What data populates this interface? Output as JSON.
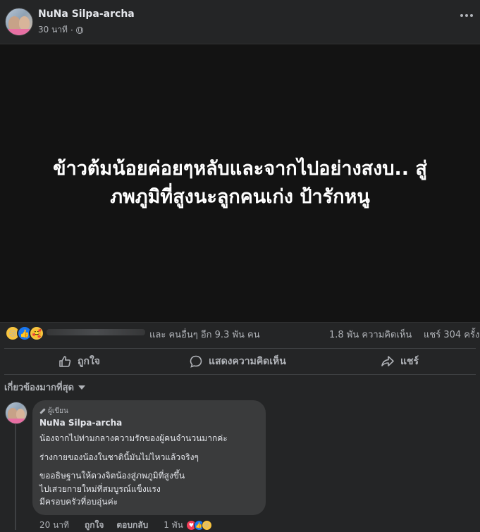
{
  "post": {
    "author": "NuNa Silpa-archa",
    "time": "30 นาที",
    "separator": "·",
    "privacy_icon": "globe-icon",
    "menu_icon": "more-horizontal-icon",
    "image_text_line1": "ข้าวต้มน้อยค่อยๆหลับและจากไปอย่างสงบ.. สู่",
    "image_text_line2": "ภพภูมิที่สูงนะลูกคนเก่ง ป้ารักหนู"
  },
  "stats": {
    "reactions": [
      "sad",
      "like",
      "care"
    ],
    "others": "และ คนอื่นๆ อีก 9.3 พัน คน",
    "comments": "1.8 พัน ความคิดเห็น",
    "shares": "แชร์ 304 ครั้ง"
  },
  "actions": {
    "like": "ถูกใจ",
    "comment": "แสดงความคิดเห็น",
    "share": "แชร์"
  },
  "comments_sort": "เกี่ยวข้องมากที่สุด",
  "comment": {
    "badge": "ผู้เขียน",
    "author": "NuNa Silpa-archa",
    "line1": "น้องจากไปท่ามกลางความรักของผู้คนจำนวนมากค่ะ",
    "line2": "ร่างกายของน้องในชาตินี้มันไม่ไหวแล้วจริงๆ",
    "line3": "ขออธิษฐานให้ดวงจิตน้องสู่ภพภูมิที่สูงขึ้น",
    "line4": "ไปเสวยกายใหม่ที่สมบูรณ์แข็งแรง",
    "line5": "มีครอบครัวที่อบอุ่นค่ะ",
    "time": "20 นาที",
    "like": "ถูกใจ",
    "reply": "ตอบกลับ",
    "reaction_count": "1 พัน"
  },
  "colors": {
    "background": "#242526",
    "image_bg": "#131313",
    "text": "#e4e6eb",
    "muted": "#b0b3b8",
    "like_blue": "#1877f2"
  }
}
